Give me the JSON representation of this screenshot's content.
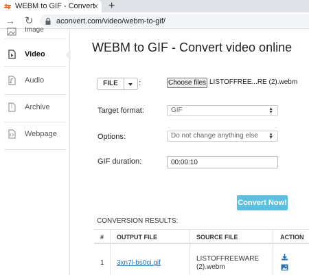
{
  "browser": {
    "tab_title": "WEBM to GIF - Convert video online",
    "tab_close": "×",
    "new_tab": "+",
    "url": "aconvert.com/video/webm-to-gif/"
  },
  "sidebar": {
    "items": [
      {
        "label": "Image",
        "icon": "image-icon"
      },
      {
        "label": "Video",
        "icon": "video-icon",
        "active": true
      },
      {
        "label": "Audio",
        "icon": "audio-icon"
      },
      {
        "label": "Archive",
        "icon": "archive-icon"
      },
      {
        "label": "Webpage",
        "icon": "webpage-icon"
      }
    ]
  },
  "main": {
    "title": "WEBM to GIF - Convert video online",
    "file_button": "FILE",
    "colon": ":",
    "choose_files": "Choose files",
    "chosen_file": "LISTOFFREE...RE (2).webm",
    "target_format_label": "Target format:",
    "target_format_value": "GIF",
    "options_label": "Options:",
    "options_value": "Do not change anything else",
    "gif_duration_label": "GIF duration:",
    "gif_duration_value": "00:00:10",
    "convert_button": "Convert Now!"
  },
  "results": {
    "title": "CONVERSION RESULTS:",
    "columns": [
      "#",
      "OUTPUT FILE",
      "SOURCE FILE",
      "ACTION"
    ],
    "rows": [
      {
        "num": "1",
        "output": "3xn7l-bs0ci.gif",
        "source_line1": "LISTOFFREEWARE",
        "source_line2": "(2).webm"
      }
    ]
  },
  "colors": {
    "accent": "#5bc0de",
    "link": "#2a6fb0"
  }
}
